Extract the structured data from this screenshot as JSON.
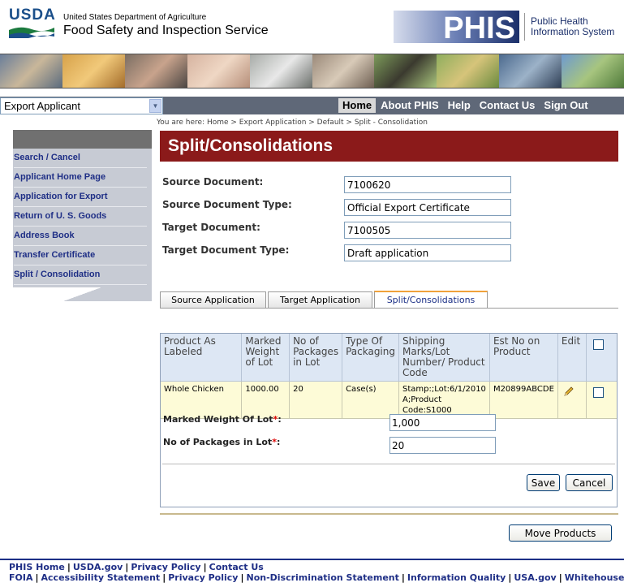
{
  "header": {
    "usda_logo_text": "USDA",
    "agency_small": "United States Department of Agriculture",
    "agency_name": "Food Safety and Inspection Service",
    "phis_logo_text": "PHIS",
    "phis_line1": "Public Health",
    "phis_line2": "Information System"
  },
  "nav": {
    "role_select_value": "Export Applicant",
    "links": [
      "Home",
      "About PHIS",
      "Help",
      "Contact Us",
      "Sign Out"
    ],
    "active_link": "Home"
  },
  "breadcrumb": "You are here: Home > Export Application > Default > Split - Consolidation",
  "sidebar": {
    "items": [
      "Search / Cancel",
      "Applicant Home Page",
      "Application for Export",
      "Return of U. S. Goods",
      "Address Book",
      "Transfer Certificate",
      "Split / Consolidation"
    ]
  },
  "page_title": "Split/Consolidations",
  "form": {
    "source_document_label": "Source Document:",
    "source_document_value": "7100620",
    "source_document_type_label": "Source Document Type:",
    "source_document_type_value": "Official Export Certificate",
    "target_document_label": "Target Document:",
    "target_document_value": "7100505",
    "target_document_type_label": "Target Document Type:",
    "target_document_type_value": "Draft application"
  },
  "tabs": [
    "Source Application",
    "Target Application",
    "Split/Consolidations"
  ],
  "active_tab": "Split/Consolidations",
  "grid": {
    "headers": [
      "Product As Labeled",
      "Marked Weight of Lot",
      "No of Packages in Lot",
      "Type Of Packaging",
      "Shipping Marks/Lot Number/ Product Code",
      "Est No on Product",
      "Edit"
    ],
    "rows": [
      {
        "product": "Whole Chicken",
        "weight": "1000.00",
        "packages": "20",
        "packaging": "Case(s)",
        "shipping": "Stamp:;Lot:6/1/2010 A;Product Code:S1000",
        "est_no": "M20899ABCDE"
      }
    ]
  },
  "edit_form": {
    "weight_label": "Marked Weight Of Lot",
    "weight_value": "1,000",
    "packages_label": "No of Packages in Lot",
    "packages_value": "20",
    "required_mark": "*",
    "save_label": "Save",
    "cancel_label": "Cancel"
  },
  "move_products_label": "Move Products",
  "footer": {
    "row1": [
      "PHIS Home",
      "USDA.gov",
      "Privacy Policy",
      "Contact Us"
    ],
    "row2": [
      "FOIA",
      "Accessibility Statement",
      "Privacy Policy",
      "Non-Discrimination Statement",
      "Information Quality",
      "USA.gov",
      "Whitehouse.gov"
    ]
  },
  "colors": {
    "title_bar": "#8b1a1a",
    "nav_bar": "#5f6878",
    "link_blue": "#1f2f86",
    "grid_header": "#dde7f4",
    "grid_row": "#fdfbd7"
  }
}
